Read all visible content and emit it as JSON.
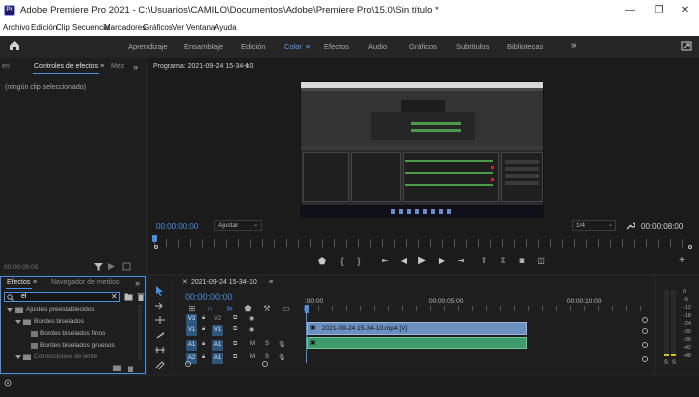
{
  "window": {
    "title": "Adobe Premiere Pro 2021 - C:\\Usuarios\\CAMILO\\Documentos\\Adobe\\Premiere Pro\\15.0\\Sin título *",
    "logo_text": "Pr",
    "minimize": "—",
    "maximize": "❐",
    "close": "✕"
  },
  "menu": [
    "Archivo",
    "Edición",
    "Clip",
    "Secuencia",
    "Marcadores",
    "Gráficos",
    "Ver",
    "Ventana",
    "Ayuda"
  ],
  "workspaces": {
    "home_icon": "home-icon",
    "items": [
      "Aprendizaje",
      "Ensamblaje",
      "Edición",
      "Color",
      "Efectos",
      "Audio",
      "Gráficos",
      "Subtítulos",
      "Bibliotecas"
    ],
    "active": "Color",
    "overflow": "»"
  },
  "source_panel": {
    "tab_prev": "eri",
    "tab_active": "Controles de efectos",
    "tab_menu": "≡",
    "tab_next": "Mez",
    "overflow": "»",
    "empty_text": "(ningún clip seleccionado)",
    "timecode": "00:00:00:00"
  },
  "program_monitor": {
    "title": "Programa: 2021-09-24 15-34-10",
    "menu": "≡",
    "timecode_current": "00:00:00:00",
    "zoom": "Ajustar",
    "resolution": "1/4",
    "timecode_duration": "00:00:08:00"
  },
  "effects_panel": {
    "tab_active": "Efectos",
    "tab_menu": "≡",
    "tab_other": "Navegador de medios",
    "overflow": "»",
    "search_value": "el",
    "tree": [
      {
        "label": "Ajustes preestablecidos",
        "level": 0
      },
      {
        "label": "Bordes biselados",
        "level": 1
      },
      {
        "label": "Bordes biselados finos",
        "level": 2
      },
      {
        "label": "Bordes biselados gruesos",
        "level": 2
      },
      {
        "label": "Correcciones de lente",
        "level": 0
      }
    ]
  },
  "timeline": {
    "close": "✕",
    "title": "2021-09-24 15-34-10",
    "menu": "≡",
    "timecode": "00:00:00:00",
    "ruler": [
      ":00:00",
      "00:00:05:00",
      "00:00:10:00"
    ],
    "tracks": [
      {
        "src": "V3",
        "dst": "V2"
      },
      {
        "src": "V1",
        "dst": "V1"
      },
      {
        "src": "A1",
        "dst": "A1"
      },
      {
        "src": "A2",
        "dst": "A1"
      }
    ],
    "video_clip": "2021-09-24 15-34-10.mp4 [V]",
    "track_letters": [
      "M",
      "S"
    ]
  },
  "audio_meter": {
    "scale": [
      "0",
      "-6",
      "-12",
      "-18",
      "-24",
      "-30",
      "-36",
      "-42",
      "-48"
    ],
    "solo_left": "S",
    "solo_right": "S"
  },
  "colors": {
    "accent": "#4a90e2",
    "video_clip": "#6b8fbf",
    "audio_clip": "#3e9a6a"
  }
}
